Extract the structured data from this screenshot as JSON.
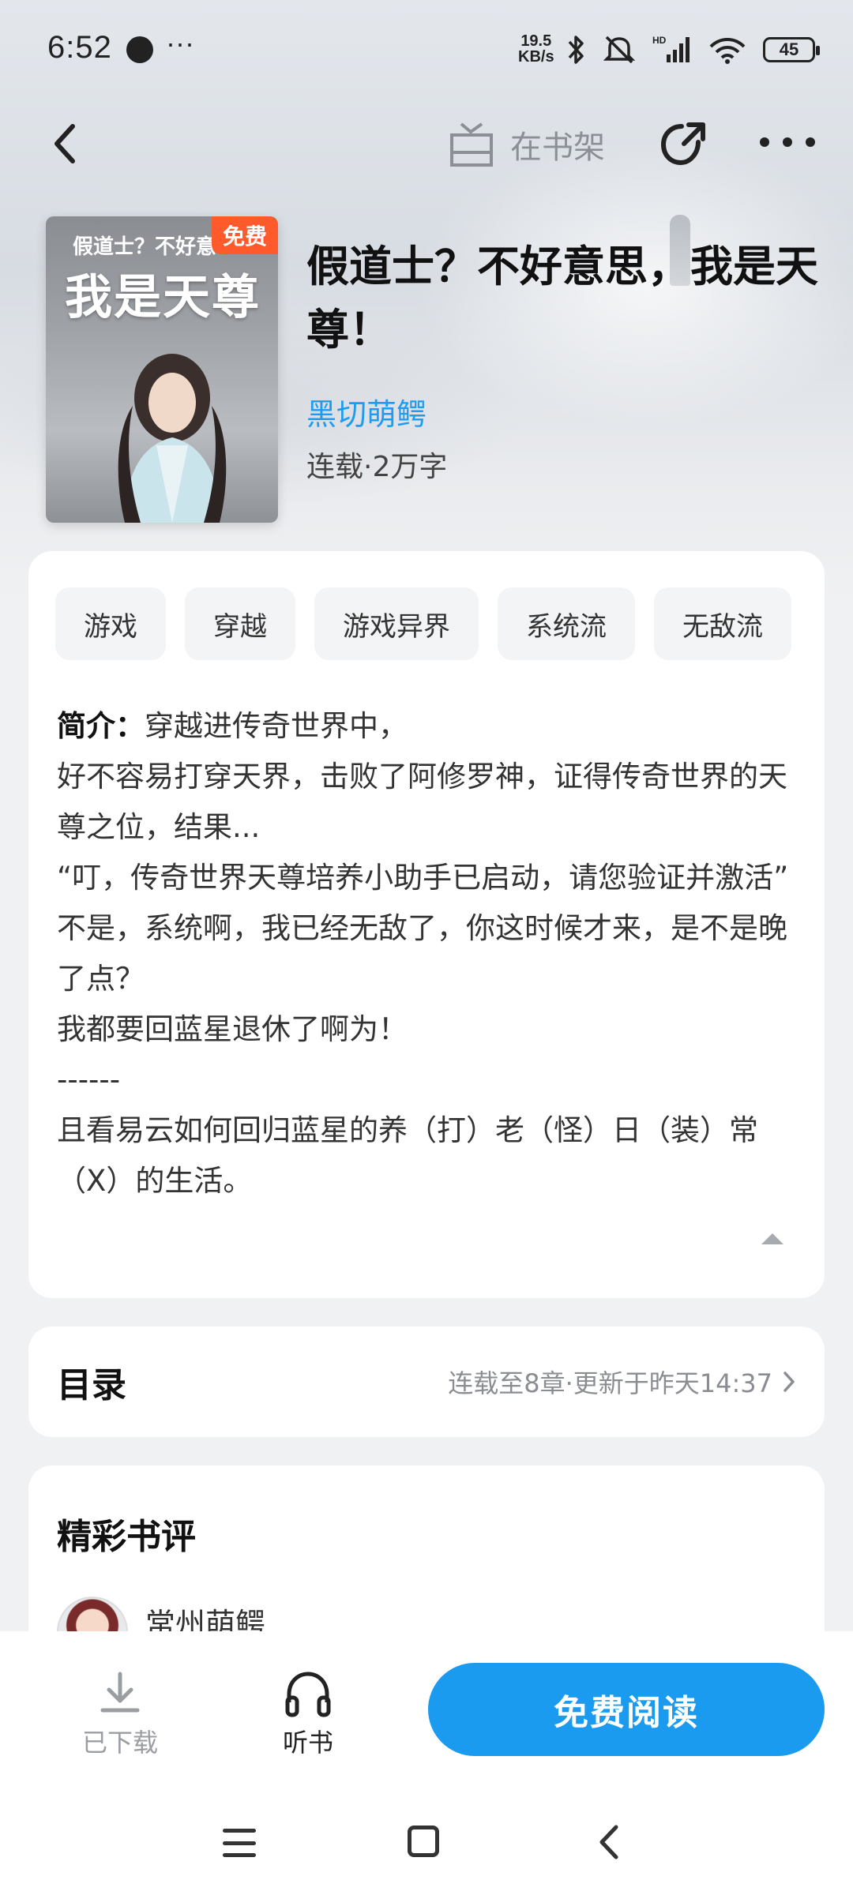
{
  "status_bar": {
    "time": "6:52",
    "net_speed_value": "19.5",
    "net_speed_unit": "KB/s",
    "battery": "45"
  },
  "top_nav": {
    "shelf_label": "在书架"
  },
  "book": {
    "cover_subtitle": "假道士？不好意",
    "cover_title": "我是天尊",
    "cover_badge": "免费",
    "title": "假道士？不好意思，我是天尊！",
    "author": "黑切萌鳄",
    "meta": "连载·2万字"
  },
  "tags": [
    "游戏",
    "穿越",
    "游戏异界",
    "系统流",
    "无敌流"
  ],
  "intro": {
    "label": "简介：",
    "text": "穿越进传奇世界中，\n好不容易打穿天界，击败了阿修罗神，证得传奇世界的天尊之位，结果...\n“叮，传奇世界天尊培养小助手已启动，请您验证并激活”\n不是，系统啊，我已经无敌了，你这时候才来，是不是晚了点？\n我都要回蓝星退休了啊为！\n------\n且看易云如何回归蓝星的养（打）老（怪）日（装）常（X）的生活。"
  },
  "toc": {
    "title": "目录",
    "info": "连载至8章·更新于昨天14:37"
  },
  "reviews": {
    "title": "精彩书评",
    "first_user": "常州萌鳄"
  },
  "bottom_bar": {
    "download_label": "已下载",
    "listen_label": "听书",
    "read_label": "免费阅读"
  },
  "colors": {
    "accent": "#1a9bf0",
    "author": "#1e9cf0",
    "badge": "#ff5a2c"
  }
}
